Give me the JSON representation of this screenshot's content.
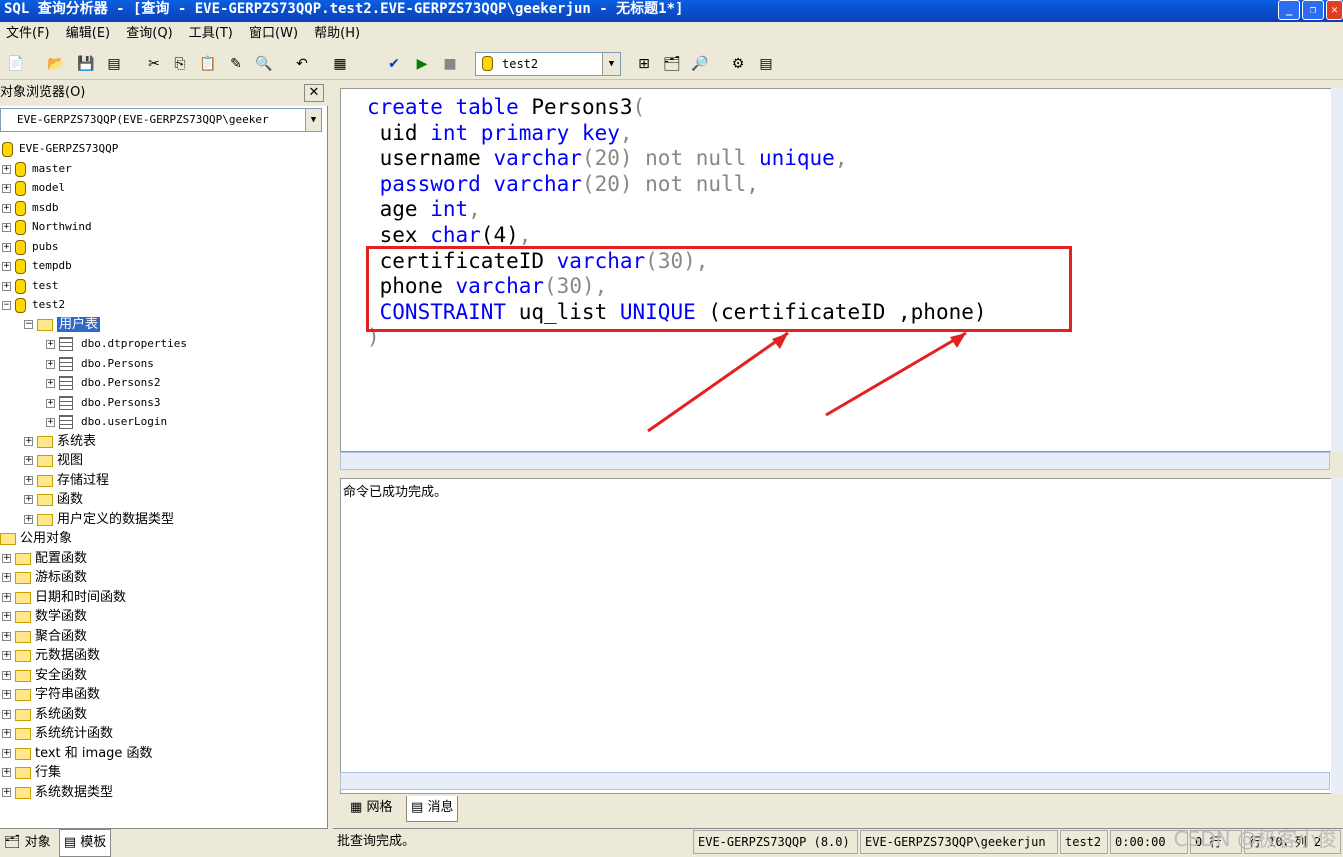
{
  "window": {
    "title": "SQL 查询分析器 - [查询 - EVE-GERPZS73QQP.test2.EVE-GERPZS73QQP\\geekerjun - 无标题1*]"
  },
  "menu": [
    "文件(F)",
    "编辑(E)",
    "查询(Q)",
    "工具(T)",
    "窗口(W)",
    "帮助(H)"
  ],
  "toolbar": {
    "database": "test2"
  },
  "browser": {
    "title": "对象浏览器(O)",
    "server_combo": "EVE-GERPZS73QQP(EVE-GERPZS73QQP\\geeker",
    "server": "EVE-GERPZS73QQP",
    "databases": [
      "master",
      "model",
      "msdb",
      "Northwind",
      "pubs",
      "tempdb",
      "test",
      "test2"
    ],
    "user_tables_folder": "用户表",
    "tables": [
      "dbo.dtproperties",
      "dbo.Persons",
      "dbo.Persons2",
      "dbo.Persons3",
      "dbo.userLogin"
    ],
    "db_folders": [
      "系统表",
      "视图",
      "存储过程",
      "函数",
      "用户定义的数据类型"
    ],
    "public_objects": "公用对象",
    "public_folders": [
      "配置函数",
      "游标函数",
      "日期和时间函数",
      "数学函数",
      "聚合函数",
      "元数据函数",
      "安全函数",
      "字符串函数",
      "系统函数",
      "系统统计函数",
      "text 和 image 函数",
      "行集",
      "系统数据类型"
    ],
    "tabs": [
      "对象",
      "模板"
    ]
  },
  "editor": {
    "lines": [
      [
        [
          "k",
          "create table "
        ],
        [
          "t",
          "Persons3"
        ],
        [
          "g",
          "("
        ]
      ],
      [
        [
          "t",
          " uid "
        ],
        [
          "k",
          "int primary key"
        ],
        [
          "g",
          ","
        ]
      ],
      [
        [
          "t",
          " username "
        ],
        [
          "k",
          "varchar"
        ],
        [
          "g",
          "(20) not null "
        ],
        [
          "k",
          "unique"
        ],
        [
          "g",
          ","
        ]
      ],
      [
        [
          "k",
          " password varchar"
        ],
        [
          "g",
          "(20) not null,"
        ]
      ],
      [
        [
          "t",
          " age "
        ],
        [
          "k",
          "int"
        ],
        [
          "g",
          ","
        ]
      ],
      [
        [
          "t",
          " sex "
        ],
        [
          "k",
          "char"
        ],
        [
          "t",
          "(4)"
        ],
        [
          "g",
          ","
        ]
      ],
      [
        [
          "t",
          " certificateID "
        ],
        [
          "k",
          "varchar"
        ],
        [
          "g",
          "(30),"
        ]
      ],
      [
        [
          "t",
          " phone "
        ],
        [
          "k",
          "varchar"
        ],
        [
          "g",
          "(30),"
        ]
      ],
      [
        [
          "k",
          " CONSTRAINT "
        ],
        [
          "t",
          "uq_list "
        ],
        [
          "k",
          "UNIQUE"
        ],
        [
          "t",
          " (certificateID ,phone)"
        ]
      ],
      [
        [
          "g",
          ")"
        ]
      ]
    ]
  },
  "results": {
    "message": "命令已成功完成。",
    "tabs": [
      "网格",
      "消息"
    ]
  },
  "status": {
    "message": "批查询完成。",
    "server": "EVE-GERPZS73QQP (8.0)",
    "user": "EVE-GERPZS73QQP\\geekerjun",
    "db": "test2",
    "time": "0:00:00",
    "rows": "0 行",
    "position": "行 10，列 2"
  },
  "watermark": "CSDN @极客小俊",
  "colors": {
    "highlight": "#e52020",
    "keyword": "#0000ff",
    "selection": "#316ac5"
  }
}
